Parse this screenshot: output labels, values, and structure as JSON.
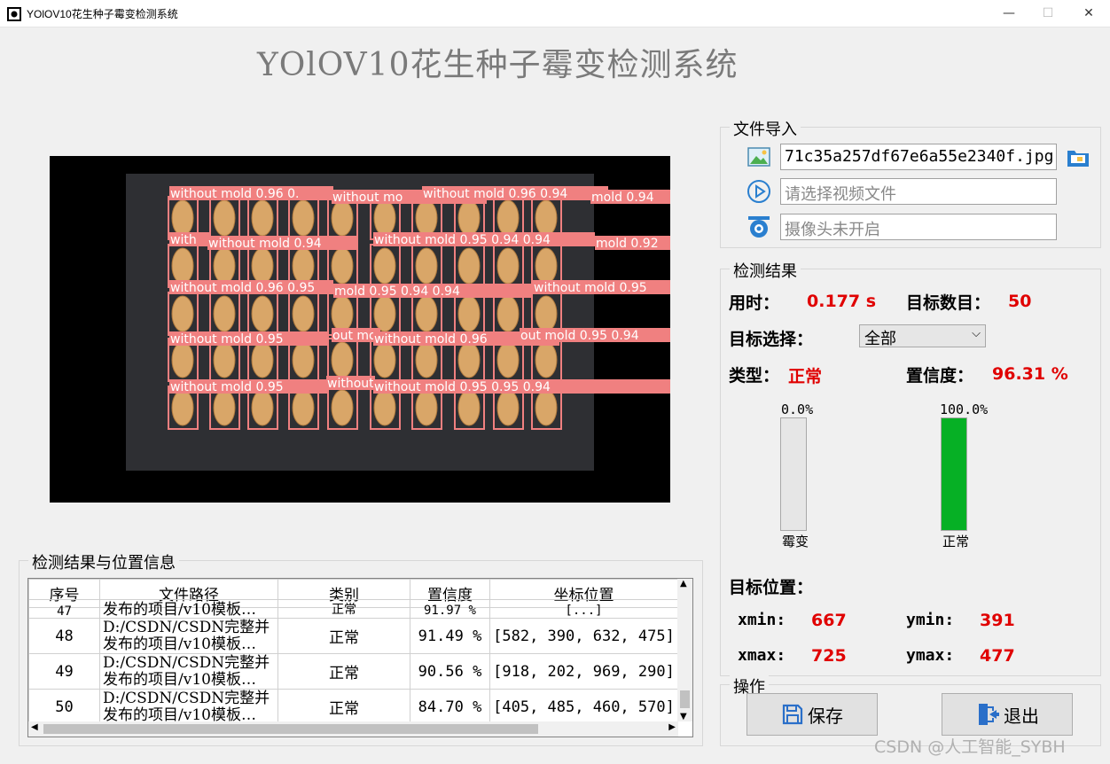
{
  "window": {
    "title": "YOlOV10花生种子霉变检测系统",
    "minimize": "—",
    "maximize": "☐",
    "close": "✕"
  },
  "app_title": "YOlOV10花生种子霉变检测系统",
  "detection_labels": [
    "without mold 0.96 0.",
    "without mo",
    "without mold 0.96 0.94",
    "mold 0.94",
    "with",
    "without mold 0.94",
    "without mold 0.95 0.94 0.94",
    "mold 0.92",
    "without mold 0.96 0.95",
    "mold 0.95 0.94 0.94",
    "without mold 0.95",
    "without mold 0.95",
    "out mo",
    "without mold 0.96",
    "out mold 0.95 0.94",
    "without mold 0.95",
    "without mo",
    "without mold 0.95 0.95 0.94"
  ],
  "file_import": {
    "title": "文件导入",
    "image_path": "71c35a257df67e6a55e2340f.jpg",
    "video_placeholder": "请选择视频文件",
    "camera_placeholder": "摄像头未开启"
  },
  "result": {
    "title": "检测结果",
    "time_label": "用时：",
    "time_value": "0.177 s",
    "count_label": "目标数目：",
    "count_value": "50",
    "target_select_label": "目标选择：",
    "target_select_value": "全部",
    "type_label": "类型：",
    "type_value": "正常",
    "conf_label": "置信度：",
    "conf_value": "96.31 %",
    "mold_bar": {
      "pct_text": "0.0%",
      "fraction": 0.0,
      "label": "霉变"
    },
    "normal_bar": {
      "pct_text": "100.0%",
      "fraction": 1.0,
      "label": "正常"
    },
    "position_label": "目标位置：",
    "xmin_label": "xmin:",
    "xmin": "667",
    "ymin_label": "ymin:",
    "ymin": "391",
    "xmax_label": "xmax:",
    "xmax": "725",
    "ymax_label": "ymax:",
    "ymax": "477"
  },
  "ops": {
    "title": "操作",
    "save": "保存",
    "exit": "退出"
  },
  "table": {
    "title": "检测结果与位置信息",
    "headers": [
      "序号",
      "文件路径",
      "类别",
      "置信度",
      "坐标位置"
    ],
    "partial_row": {
      "index": "47",
      "path": "发布的项目/v10模板…",
      "cls": "正常",
      "conf": "91.97 %",
      "coord": "[...]"
    },
    "rows": [
      {
        "index": "48",
        "path": "D:/CSDN/CSDN完整并发布的项目/v10模板…",
        "cls": "正常",
        "conf": "91.49 %",
        "coord": "[582, 390, 632, 475]"
      },
      {
        "index": "49",
        "path": "D:/CSDN/CSDN完整并发布的项目/v10模板…",
        "cls": "正常",
        "conf": "90.56 %",
        "coord": "[918, 202, 969, 290]"
      },
      {
        "index": "50",
        "path": "D:/CSDN/CSDN完整并发布的项目/v10模板…",
        "cls": "正常",
        "conf": "84.70 %",
        "coord": "[405, 485, 460, 570]"
      }
    ]
  },
  "watermark": "CSDN @人工智能_SYBH"
}
